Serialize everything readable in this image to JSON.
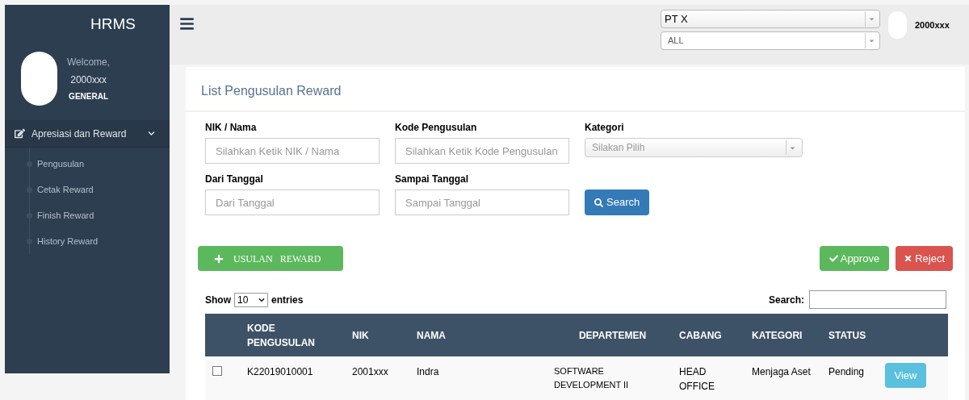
{
  "sidebar": {
    "brand": "HRMS",
    "welcome": "Welcome,",
    "user": "2000xxx",
    "role": "GENERAL",
    "menu": {
      "label": "Apresiasi dan Reward",
      "expanded": true,
      "items": [
        {
          "label": "Pengusulan",
          "selected": false
        },
        {
          "label": "Cetak Reward",
          "selected": false
        },
        {
          "label": "Finish Reward",
          "selected": false
        },
        {
          "label": "History Reward",
          "selected": false
        }
      ]
    }
  },
  "topbar": {
    "company": "PT X",
    "branch": "ALL",
    "user": "2000xxx"
  },
  "page": {
    "title": "List Pengusulan Reward",
    "filters": [
      {
        "label": "NIK / Nama",
        "placeholder": "Silahkan Ketik NIK / Nama",
        "kind": "input"
      },
      {
        "label": "Kode Pengusulan",
        "placeholder": "Silahkan Ketik Kode Pengusulan",
        "kind": "input"
      },
      {
        "label": "Kategori",
        "placeholder": "Silakan Pilih",
        "kind": "select"
      },
      {
        "label": "Dari Tanggal",
        "placeholder": "Dari Tanggal",
        "kind": "input"
      },
      {
        "label": "Sampai Tanggal",
        "placeholder": "Sampai Tanggal",
        "kind": "input"
      }
    ],
    "search_button": "Search",
    "add_button": "USULAN   REWARD",
    "approve_button": "Approve",
    "reject_button": "Reject",
    "show_label": "Show",
    "page_size": "10",
    "entries_label": "entries",
    "search_label": "Search:"
  },
  "table": {
    "columns": [
      "KODE PENGUSULAN",
      "NIK",
      "NAMA",
      "DEPARTEMEN",
      "CABANG",
      "KATEGORI",
      "STATUS"
    ],
    "rows": [
      {
        "checked": false,
        "cells": [
          "K22019010001",
          "2001xxx",
          "Indra",
          "SOFTWARE DEVELOPMENT II",
          "HEAD OFFICE",
          "Menjaga Aset",
          "Pending"
        ],
        "action": "View"
      }
    ]
  }
}
